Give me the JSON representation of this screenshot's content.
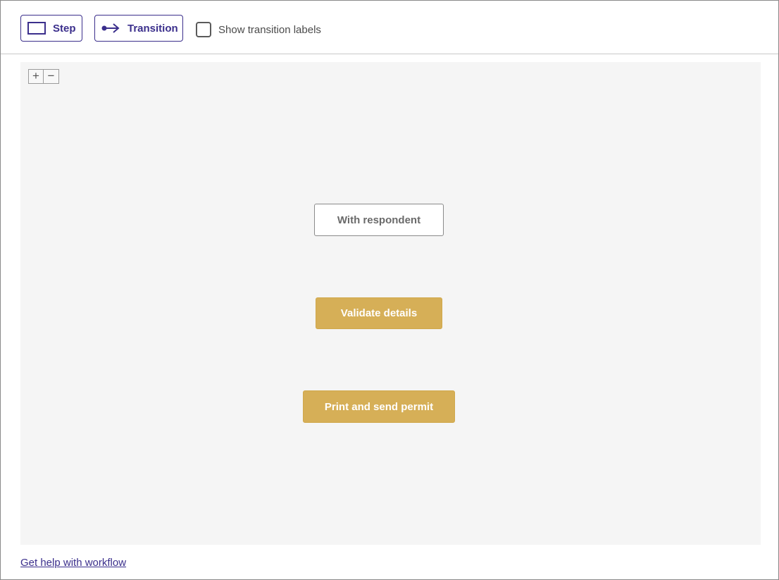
{
  "toolbar": {
    "step_label": "Step",
    "transition_label": "Transition",
    "show_labels_text": "Show transition labels",
    "show_labels_checked": false
  },
  "canvas": {
    "zoom_in": "+",
    "zoom_out": "−",
    "nodes": [
      {
        "label": "With respondent",
        "style": "outline"
      },
      {
        "label": "Validate details",
        "style": "filled"
      },
      {
        "label": "Print and send permit",
        "style": "filled"
      }
    ]
  },
  "footer": {
    "help_link": "Get help with workflow"
  },
  "colors": {
    "accent": "#3b2f8c",
    "step_fill": "#d6af57",
    "canvas_bg": "#f5f5f5"
  },
  "icons": {
    "step": "rectangle-icon",
    "transition": "arrow-right-icon"
  }
}
